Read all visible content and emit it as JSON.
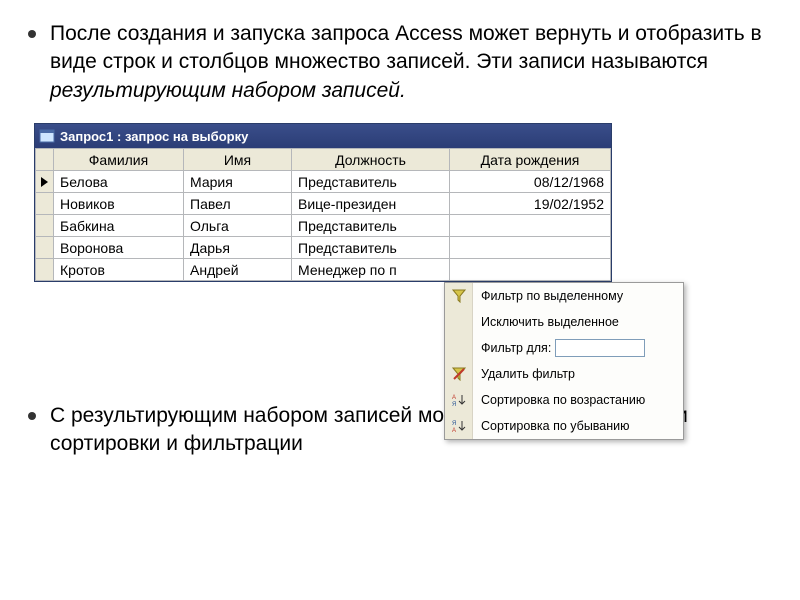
{
  "bullets": {
    "top_pre": "После создания и запуска запроса Access может вернуть и отобразить в виде строк и столбцов множество записей. Эти записи называются ",
    "top_italic": "результирующим набором записей.",
    "bottom": "С результирующим набором записей можно проводить операции сортировки и фильтрации"
  },
  "db": {
    "title": "Запрос1 : запрос на выборку",
    "headers": {
      "surname": "Фамилия",
      "name": "Имя",
      "position": "Должность",
      "birthdate": "Дата рождения"
    },
    "rows": [
      {
        "surname": "Белова",
        "name": "Мария",
        "position": "Представитель",
        "birthdate": "08/12/1968",
        "current": true
      },
      {
        "surname": "Новиков",
        "name": "Павел",
        "position": "Вице-президен",
        "birthdate": "19/02/1952",
        "current": false
      },
      {
        "surname": "Бабкина",
        "name": "Ольга",
        "position": "Представитель",
        "birthdate": "",
        "current": false
      },
      {
        "surname": "Воронова",
        "name": "Дарья",
        "position": "Представитель",
        "birthdate": "",
        "current": false
      },
      {
        "surname": "Кротов",
        "name": "Андрей",
        "position": "Менеджер по п",
        "birthdate": "",
        "current": false
      }
    ]
  },
  "menu": {
    "filter_selected": "Фильтр по выделенному",
    "exclude_selected": "Исключить выделенное",
    "filter_for_label": "Фильтр для:",
    "filter_for_value": "",
    "remove_filter": "Удалить фильтр",
    "sort_asc": "Сортировка по возрастанию",
    "sort_desc": "Сортировка по убыванию"
  }
}
